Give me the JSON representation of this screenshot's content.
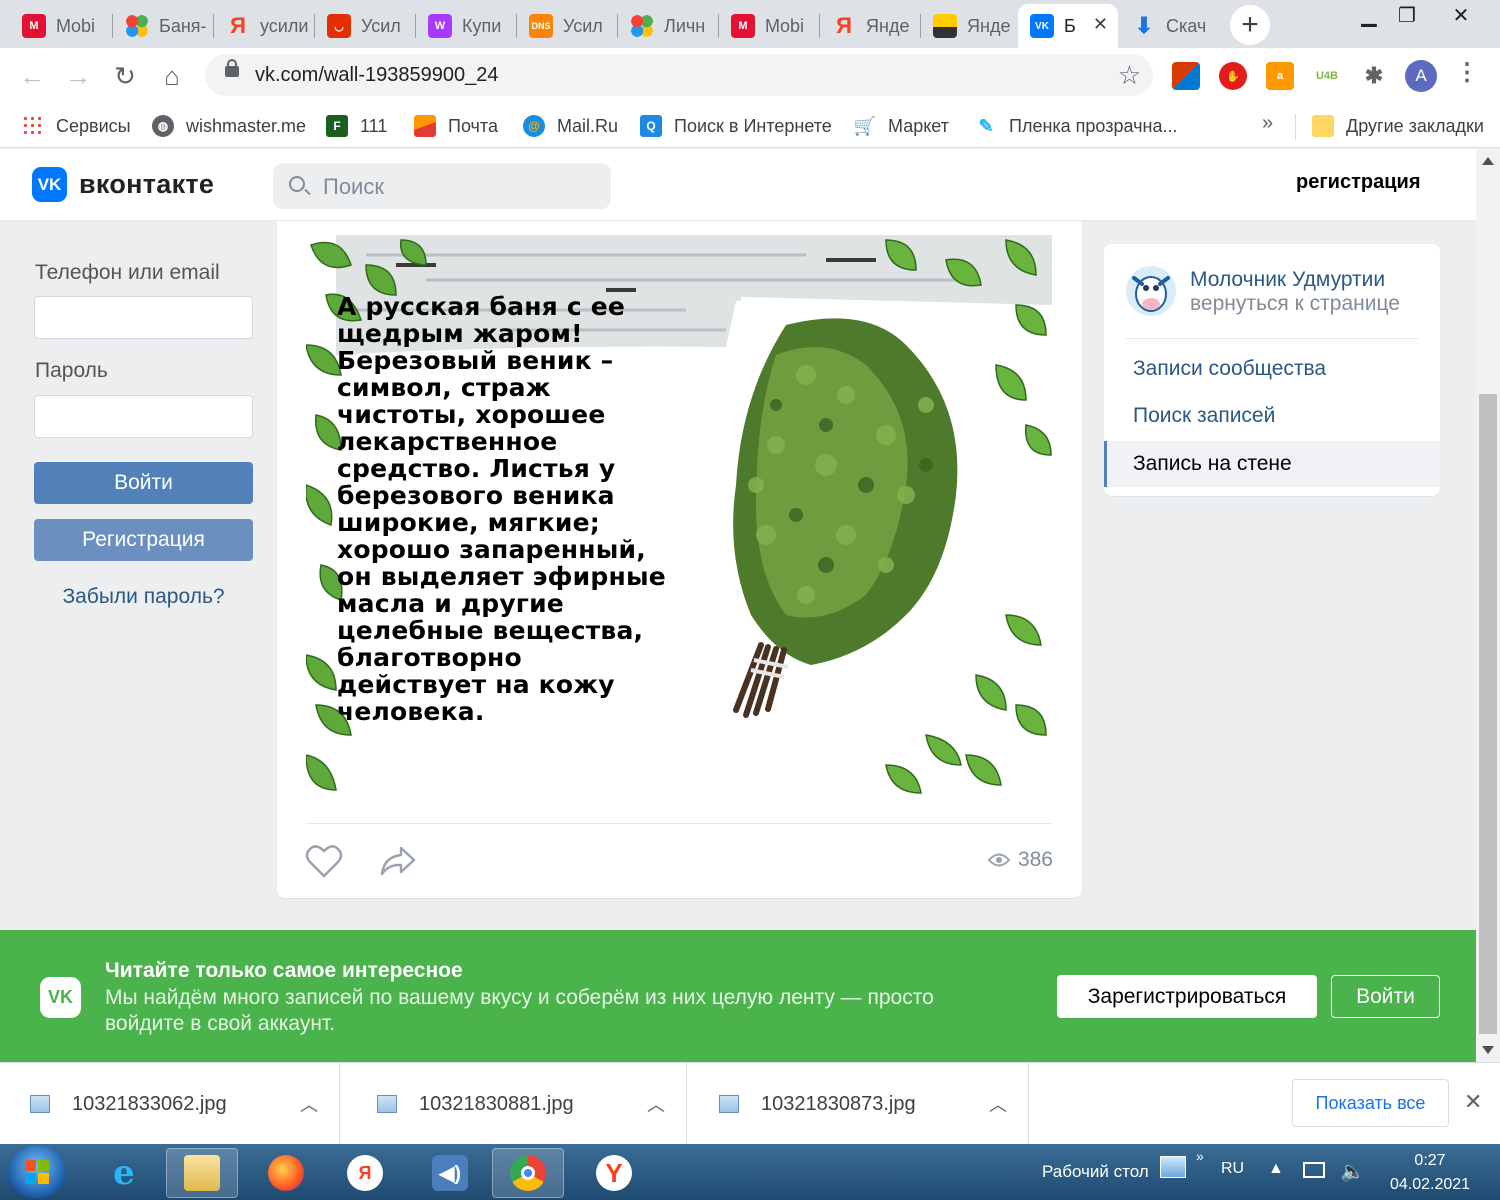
{
  "browser": {
    "tabs": [
      {
        "label": "Mobi",
        "icon": "mvideo-icon",
        "color": "#e31235"
      },
      {
        "label": "Баня-",
        "icon": "dots-icon",
        "color": "#ffffff"
      },
      {
        "label": "усили",
        "icon": "yandex-icon",
        "color": "#ffffff"
      },
      {
        "label": "Усил",
        "icon": "aliexpress-icon",
        "color": "#e62e04"
      },
      {
        "label": "Купи",
        "icon": "wildberries-icon",
        "color": "#a73afd"
      },
      {
        "label": "Усил",
        "icon": "dns-icon",
        "color": "#fc8507"
      },
      {
        "label": "Личн",
        "icon": "dots-icon",
        "color": "#ffffff"
      },
      {
        "label": "Mobi",
        "icon": "mvideo-icon",
        "color": "#e31235"
      },
      {
        "label": "Янде",
        "icon": "yandex-icon",
        "color": "#ffffff"
      },
      {
        "label": "Янде",
        "icon": "image-icon",
        "color": "#ffcc00"
      },
      {
        "label": "Б",
        "icon": "vk-icon",
        "color": "#0077ff",
        "active": true
      },
      {
        "label": "Скач",
        "icon": "download-icon",
        "color": "#ffffff"
      }
    ],
    "url": "vk.com/wall-193859900_24",
    "profile_initial": "A",
    "extensions": [
      {
        "icon": "microsoft-office-icon",
        "color": "#0078d4",
        "label": ""
      },
      {
        "icon": "adblock-icon",
        "color": "#e21b1b",
        "label": ""
      },
      {
        "icon": "aliexpress-icon",
        "color": "#ff9900",
        "label": "a"
      },
      {
        "icon": "u4b-icon",
        "color": "#ffffff",
        "label": "U4B"
      }
    ],
    "bookmarks": [
      {
        "label": "Сервисы",
        "icon": "apps-grid-icon",
        "color": "#ea4335"
      },
      {
        "label": "wishmaster.me",
        "icon": "globe-icon",
        "color": "#5f6368"
      },
      {
        "label": "111",
        "icon": "f-icon",
        "color": "#1b5e20"
      },
      {
        "label": "Почта",
        "icon": "mail-envelope-icon",
        "color": "#ff9800"
      },
      {
        "label": "Mail.Ru",
        "icon": "at-sign-icon",
        "color": "#168de2"
      },
      {
        "label": "Поиск в Интернете",
        "icon": "search-square-icon",
        "color": "#1e88e5"
      },
      {
        "label": "Маркет",
        "icon": "cart-icon",
        "color": "#1565c0"
      },
      {
        "label": "Пленка прозрачна...",
        "icon": "pen-icon",
        "color": "#29b6f6"
      }
    ],
    "other_bookmarks": "Другие закладки",
    "more_bookmarks": "»"
  },
  "vk": {
    "logo_text": "вконтакте",
    "logo_mark": "VK",
    "search_placeholder": "Поиск",
    "register_link": "регистрация",
    "login": {
      "phone_label": "Телефон или email",
      "password_label": "Пароль",
      "login_button": "Войти",
      "register_button": "Регистрация",
      "forgot_link": "Забыли пароль?",
      "primary_color": "#5181b8",
      "secondary_color": "#6b8fc0"
    },
    "post": {
      "text": " А русская баня с ее\nщедрым жаром!\nБерезовый веник –\nсимвол, страж\nчистоты, хорошее\nлекарственное\nсредство. Листья у\nберезового веника\nширокие, мягкие;\nхорошо запаренный,\nон выделяет эфирные\nмасла и другие\nцелебные вещества,\nблаготворно\nдействует на кожу\nчеловека.",
      "views": "386"
    },
    "group": {
      "name": "Молочник Удмуртии",
      "back": "вернуться к странице",
      "nav": [
        {
          "label": "Записи сообщества",
          "active": false
        },
        {
          "label": "Поиск записей",
          "active": false
        },
        {
          "label": "Запись на стене",
          "active": true
        }
      ]
    },
    "promo": {
      "title": "Читайте только самое интересное",
      "text": "Мы найдём много записей по вашему вкусу и соберём из них целую ленту — просто войдите в свой аккаунт.",
      "register_button": "Зарегистрироваться",
      "login_button": "Войти",
      "color": "#4bb34b"
    }
  },
  "downloads": {
    "items": [
      {
        "name": "10321833062.jpg"
      },
      {
        "name": "10321830881.jpg"
      },
      {
        "name": "10321830873.jpg"
      }
    ],
    "show_all": "Показать все"
  },
  "taskbar": {
    "desktop_label": "Рабочий стол",
    "language": "RU",
    "time": "0:27",
    "date": "04.02.2021"
  }
}
